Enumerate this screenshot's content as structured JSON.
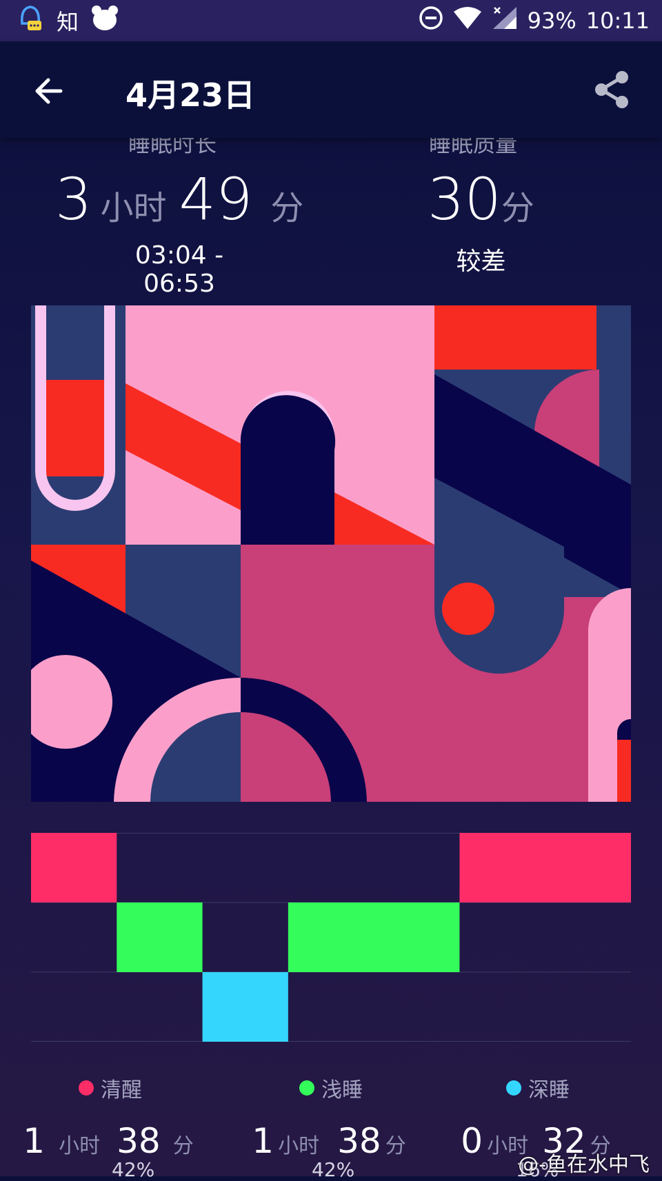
{
  "status_bar": {
    "app_char": "知",
    "battery": "93%",
    "time": "10:11",
    "icons": [
      "qq-bell-icon",
      "zhihu-icon",
      "bear-icon",
      "dnd-icon",
      "wifi-icon",
      "no-signal-icon"
    ]
  },
  "header": {
    "title": "4月23日",
    "back_icon": "arrow-left-icon",
    "share_icon": "share-icon"
  },
  "summary": {
    "duration_label": "睡眠时长",
    "duration_hours": "3",
    "hour_unit": "小时",
    "duration_minutes": "49",
    "minute_unit": "分",
    "time_range": "03:04 - 06:53",
    "quality_label": "睡眠质量",
    "quality_score": "30",
    "score_unit": "分",
    "quality_text": "较差"
  },
  "colors": {
    "awake": "#fe2d68",
    "light": "#34fc5a",
    "deep": "#35d6fe"
  },
  "stages_chart": {
    "rows": [
      "清醒",
      "浅睡",
      "深睡"
    ],
    "segments": [
      {
        "stage": "清醒",
        "units": 1
      },
      {
        "stage": "浅睡",
        "units": 1
      },
      {
        "stage": "深睡",
        "units": 1
      },
      {
        "stage": "浅睡",
        "units": 2
      },
      {
        "stage": "清醒",
        "units": 2
      }
    ]
  },
  "legend": [
    {
      "label": "清醒",
      "hours": "1",
      "hour_unit": "小时",
      "minutes": "38",
      "minute_unit": "分",
      "percent": "42%"
    },
    {
      "label": "浅睡",
      "hours": "1",
      "hour_unit": "小时",
      "minutes": "38",
      "minute_unit": "分",
      "percent": "42%"
    },
    {
      "label": "深睡",
      "hours": "0",
      "hour_unit": "小时",
      "minutes": "32",
      "minute_unit": "分",
      "percent": "16%"
    }
  ],
  "watermark": "@-鱼在水中飞"
}
